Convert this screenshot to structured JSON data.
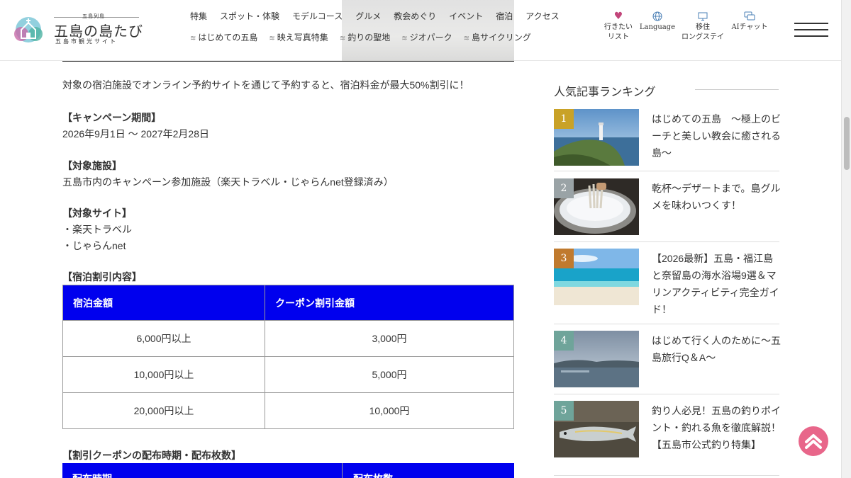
{
  "header": {
    "logo_sub": "五島列島",
    "logo_title": "五島の島たび",
    "logo_tag": "五島市観光サイト",
    "nav_top": [
      "特集",
      "スポット・体験",
      "モデルコース",
      "グルメ",
      "教会めぐり",
      "イベント",
      "宿泊",
      "アクセス"
    ],
    "nav_bottom": [
      "はじめての五島",
      "映え写真特集",
      "釣りの聖地",
      "ジオパーク",
      "島サイクリング"
    ],
    "utility": {
      "wishlist_line1": "行きたい",
      "wishlist_line2": "リスト",
      "language": "Language",
      "longstay_line1": "移住",
      "longstay_line2": "ロングステイ",
      "ai_chat": "AIチャット"
    }
  },
  "article": {
    "intro": "対象の宿泊施設でオンライン予約サイトを通じて予約すると、宿泊料金が最大50%割引に！",
    "period_heading": "【キャンペーン期間】",
    "period_value": "2026年9月1日 〜 2027年2月28日",
    "facility_heading": "【対象施設】",
    "facility_value": "五島市内のキャンペーン参加施設（楽天トラベル・じゃらんnet登録済み）",
    "sites_heading": "【対象サイト】",
    "sites": [
      "・楽天トラベル",
      "・じゃらんnet"
    ],
    "discount_heading": "【宿泊割引内容】",
    "discount_table": {
      "headers": [
        "宿泊金額",
        "クーポン割引金額"
      ],
      "rows": [
        [
          "6,000円以上",
          "3,000円"
        ],
        [
          "10,000円以上",
          "5,000円"
        ],
        [
          "20,000円以上",
          "10,000円"
        ]
      ]
    },
    "coupon_heading": "【割引クーポンの配布時期・配布枚数】",
    "coupon_table_headers": [
      "配布時期",
      "配布枚数"
    ]
  },
  "sidebar": {
    "title": "人気記事ランキング",
    "rankings": [
      {
        "rank": "1",
        "title": "はじめての五島　〜極上のビーチと美しい教会に癒される島〜"
      },
      {
        "rank": "2",
        "title": "乾杯〜デザートまで。島グルメを味わいつくす！"
      },
      {
        "rank": "3",
        "title": "【2026最新】五島・福江島と奈留島の海水浴場9選＆マリンアクティビティ完全ガイド！"
      },
      {
        "rank": "4",
        "title": "はじめて行く人のために〜五島旅行Q＆A〜"
      },
      {
        "rank": "5",
        "title": "釣り人必見！五島の釣りポイント・釣れる魚を徹底解説！【五島市公式釣り特集】"
      }
    ]
  },
  "colors": {
    "table_header": "#0000ee",
    "rank_gold": "#c9a227",
    "rank_silver": "#9aa3a6",
    "rank_bronze": "#c07a2e",
    "rank_other": "#6fa49a",
    "to_top": "#e8668a",
    "wishlist_heart": "#c2457a"
  },
  "icons": [
    "heart-icon",
    "globe-icon",
    "monitor-icon",
    "chat-icon",
    "hamburger-menu-icon",
    "chevron-up-icon"
  ]
}
